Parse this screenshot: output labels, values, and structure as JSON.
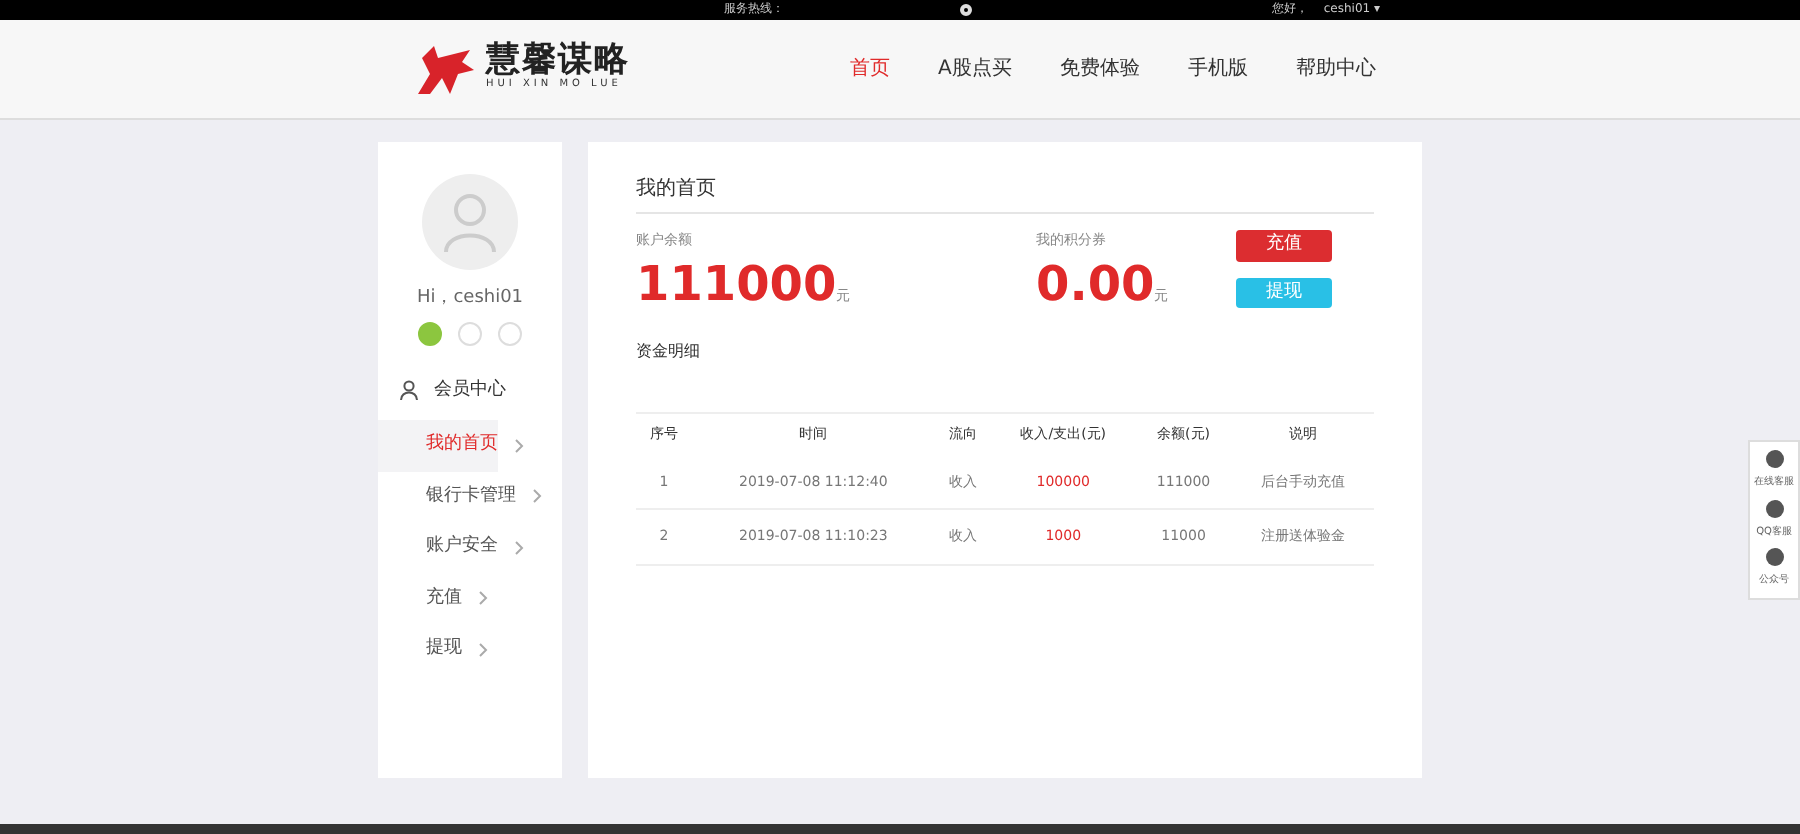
{
  "topbar": {
    "hotline_label": "服务热线：",
    "greeting": "您好，",
    "username": "ceshi01",
    "caret": "▾"
  },
  "logo": {
    "title": "慧馨谋略",
    "subtitle": "HUI XIN MO LUE"
  },
  "nav": [
    {
      "label": "首页",
      "selected": true
    },
    {
      "label": "A股点买",
      "selected": false
    },
    {
      "label": "免费体验",
      "selected": false
    },
    {
      "label": "手机版",
      "selected": false
    },
    {
      "label": "帮助中心",
      "selected": false
    }
  ],
  "sidebar": {
    "greeting": "Hi，ceshi01",
    "section": "会员中心",
    "items": [
      {
        "label": "我的首页",
        "selected": true
      },
      {
        "label": "银行卡管理",
        "selected": false
      },
      {
        "label": "账户安全",
        "selected": false
      },
      {
        "label": "充值",
        "selected": false
      },
      {
        "label": "提现",
        "selected": false
      }
    ]
  },
  "main": {
    "title": "我的首页",
    "balances": [
      {
        "label": "账户余额",
        "amount": "111000",
        "unit": "元"
      },
      {
        "label": "我的积分券",
        "amount": "0.00",
        "unit": "元"
      }
    ],
    "buttons": [
      {
        "label": "充值",
        "kind": "danger"
      },
      {
        "label": "提现",
        "kind": "info"
      }
    ],
    "detail_title": "资金明细",
    "table": {
      "columns": [
        "序号",
        "时间",
        "流向",
        "收入/支出(元)",
        "余额(元)",
        "说明"
      ],
      "rows": [
        [
          "1",
          "2019-07-08 11:12:40",
          "收入",
          "100000",
          "111000",
          "后台手动充值"
        ],
        [
          "2",
          "2019-07-08 11:10:23",
          "收入",
          "1000",
          "11000",
          "注册送体验金"
        ]
      ]
    }
  },
  "float_bar": [
    "在线客服",
    "QQ客服",
    "公众号"
  ]
}
